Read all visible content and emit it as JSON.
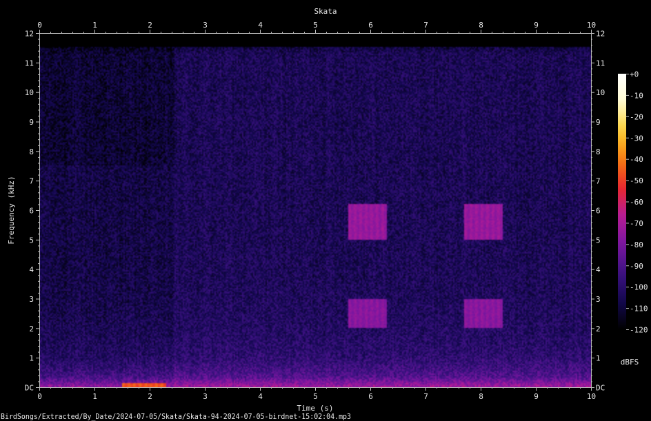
{
  "chart_data": {
    "type": "heatmap",
    "title": "Skata",
    "xlabel": "Time (s)",
    "ylabel": "Frequency (kHz)",
    "xlim": [
      0,
      10
    ],
    "ylim": [
      0,
      12
    ],
    "x_ticks": [
      "0",
      "1",
      "2",
      "3",
      "4",
      "5",
      "6",
      "7",
      "8",
      "9",
      "10"
    ],
    "y_ticks": [
      "DC",
      "1",
      "2",
      "3",
      "4",
      "5",
      "6",
      "7",
      "8",
      "9",
      "10",
      "11",
      "12"
    ],
    "colorbar": {
      "label": "dBFS",
      "range": [
        -120,
        0
      ],
      "ticks": [
        "+0",
        "-10",
        "-20",
        "-30",
        "-40",
        "-50",
        "-60",
        "-70",
        "-80",
        "-90",
        "-100",
        "-110",
        "-120"
      ]
    },
    "grid": false,
    "colormap": [
      "#000000",
      "#13084f",
      "#3d1283",
      "#7a16a0",
      "#b71c96",
      "#e8282c",
      "#f67d11",
      "#fbcf34",
      "#fffbd0",
      "#ffffff"
    ],
    "features": [
      {
        "t_start": 5.6,
        "t_end": 6.3,
        "f_low": 5.0,
        "f_high": 6.2,
        "level_db": -72
      },
      {
        "t_start": 5.6,
        "t_end": 6.3,
        "f_low": 2.0,
        "f_high": 3.0,
        "level_db": -75
      },
      {
        "t_start": 7.7,
        "t_end": 8.4,
        "f_low": 5.0,
        "f_high": 6.2,
        "level_db": -72
      },
      {
        "t_start": 7.7,
        "t_end": 8.4,
        "f_low": 2.0,
        "f_high": 3.0,
        "level_db": -75
      },
      {
        "t_start": 1.5,
        "t_end": 2.3,
        "f_low": 0.0,
        "f_high": 0.15,
        "level_db": -45
      }
    ]
  },
  "footer": {
    "file_path": "BirdSongs/Extracted/By_Date/2024-07-05/Skata/Skata-94-2024-07-05-birdnet-15:02:04.mp3"
  }
}
